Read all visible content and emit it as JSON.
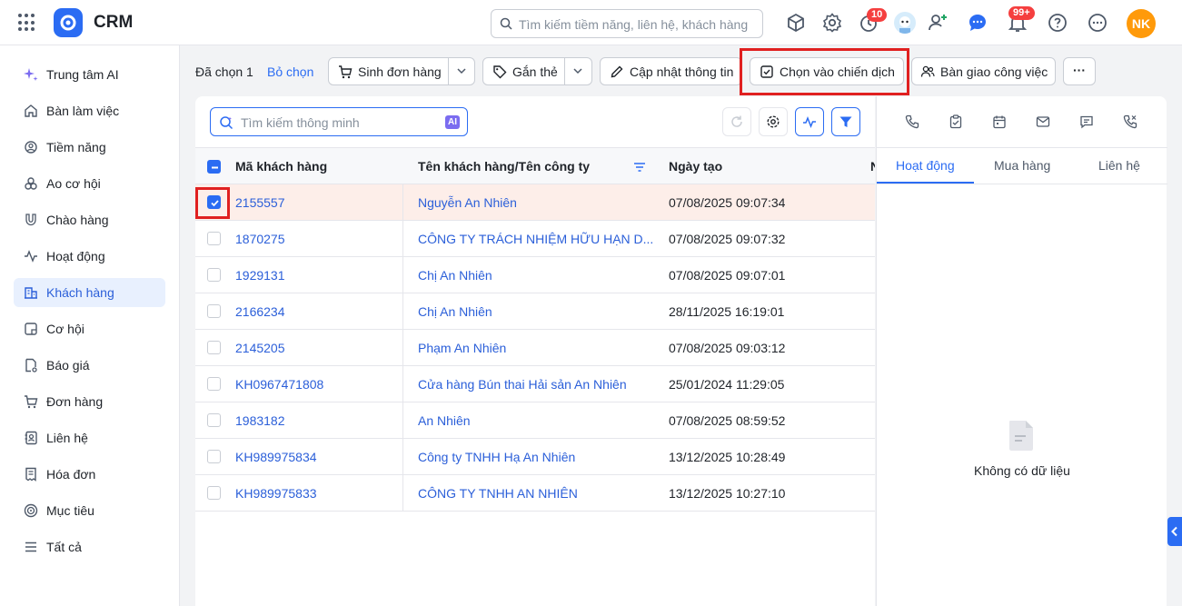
{
  "header": {
    "app_name": "CRM",
    "search_placeholder": "Tìm kiếm tiềm năng, liên hệ, khách hàng",
    "timer_badge": "10",
    "notification_badge": "99+",
    "user_initials": "NK",
    "accent_color": "#2b6cf3"
  },
  "sidebar": {
    "items": [
      {
        "label": "Trung tâm AI",
        "icon": "sparkle-icon"
      },
      {
        "label": "Bàn làm việc",
        "icon": "home-icon"
      },
      {
        "label": "Tiềm năng",
        "icon": "target-user-icon"
      },
      {
        "label": "Ao cơ hội",
        "icon": "users-icon"
      },
      {
        "label": "Chào hàng",
        "icon": "magnet-icon"
      },
      {
        "label": "Hoạt động",
        "icon": "activity-icon"
      },
      {
        "label": "Khách hàng",
        "icon": "building-icon",
        "active": true
      },
      {
        "label": "Cơ hội",
        "icon": "opportunity-icon"
      },
      {
        "label": "Báo giá",
        "icon": "quote-icon"
      },
      {
        "label": "Đơn hàng",
        "icon": "cart-icon"
      },
      {
        "label": "Liên hệ",
        "icon": "contact-icon"
      },
      {
        "label": "Hóa đơn",
        "icon": "invoice-icon"
      },
      {
        "label": "Mục tiêu",
        "icon": "goal-icon"
      },
      {
        "label": "Tất cả",
        "icon": "menu-icon"
      }
    ]
  },
  "action_bar": {
    "selected_count": "Đã chọn 1",
    "deselect": "Bỏ chọn",
    "create_order": "Sinh đơn hàng",
    "tag": "Gắn thẻ",
    "update_info": "Cập nhật thông tin",
    "add_to_campaign": "Chọn vào chiến dịch",
    "handover": "Bàn giao công việc",
    "more": "···"
  },
  "table": {
    "search_placeholder": "Tìm kiếm thông minh",
    "ai_tag": "AI",
    "columns": [
      "Mã khách hàng",
      "Tên khách hàng/Tên công ty",
      "Ngày tạo",
      "N"
    ],
    "rows": [
      {
        "code": "2155557",
        "name": "Nguyễn An Nhiên",
        "created": "07/08/2025 09:07:34",
        "selected": true
      },
      {
        "code": "1870275",
        "name": "CÔNG TY TRÁCH NHIỆM HỮU HẠN D...",
        "created": "07/08/2025 09:07:32"
      },
      {
        "code": "1929131",
        "name": "Chị An Nhiên",
        "created": "07/08/2025 09:07:01"
      },
      {
        "code": "2166234",
        "name": "Chị An Nhiên",
        "created": "28/11/2025 16:19:01"
      },
      {
        "code": "2145205",
        "name": "Phạm An Nhiên",
        "created": "07/08/2025 09:03:12"
      },
      {
        "code": "KH0967471808",
        "name": "Cửa hàng Bún thai Hải sản An Nhiên",
        "created": "25/01/2024 11:29:05"
      },
      {
        "code": "1983182",
        "name": "An Nhiên",
        "created": "07/08/2025 08:59:52"
      },
      {
        "code": "KH989975834",
        "name": "Công ty TNHH Hạ An Nhiên",
        "created": "13/12/2025 10:28:49"
      },
      {
        "code": "KH989975833",
        "name": "CÔNG TY TNHH AN NHIÊN",
        "created": "13/12/2025 10:27:10"
      }
    ]
  },
  "detail": {
    "quick_actions": [
      "phone-icon",
      "task-icon",
      "calendar-icon",
      "mail-icon",
      "message-icon",
      "call-log-icon"
    ],
    "tabs": [
      "Hoạt động",
      "Mua hàng",
      "Liên hệ"
    ],
    "empty_text": "Không có dữ liệu"
  }
}
